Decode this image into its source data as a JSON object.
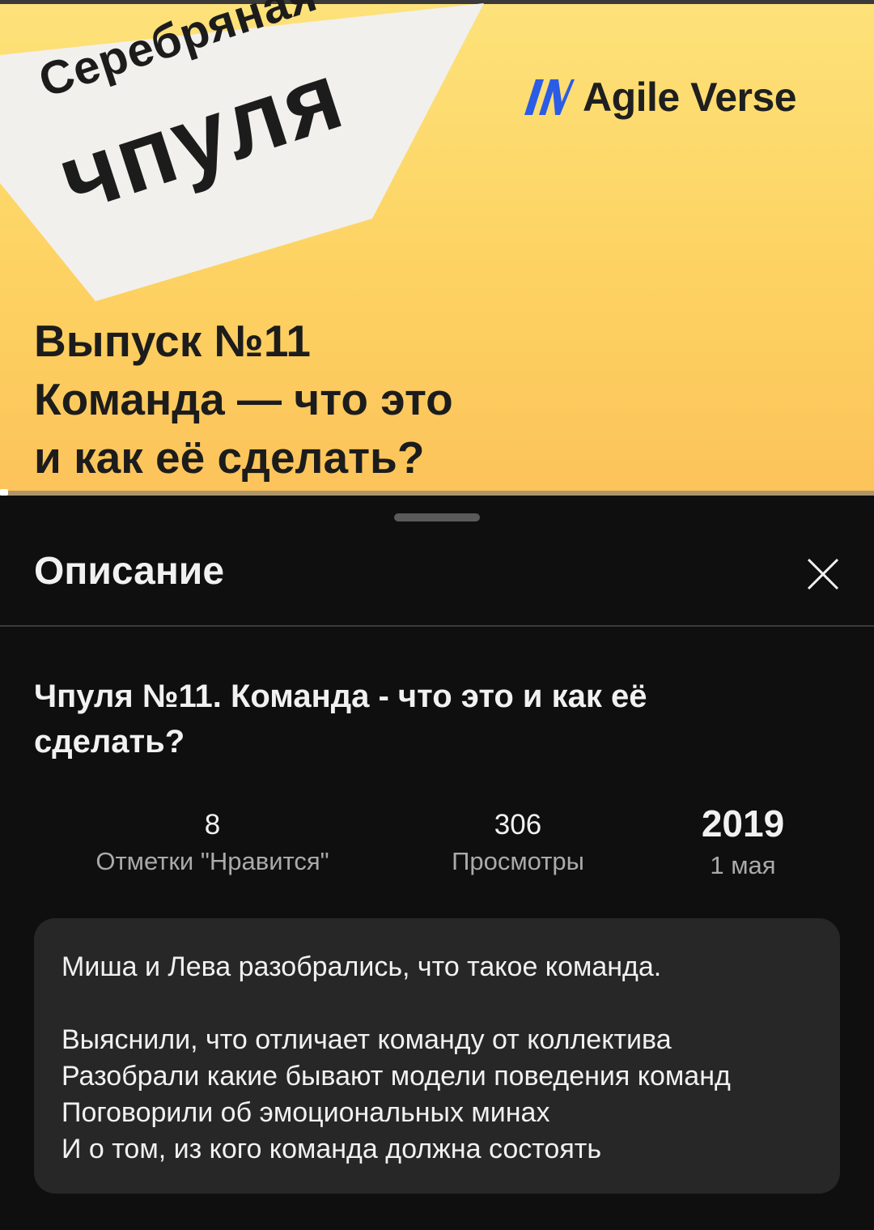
{
  "video": {
    "show_name_line1": "Серебряная",
    "show_name_line2": "чпуля",
    "logo_text": "Agile Verse",
    "episode_line1": "Выпуск №11",
    "episode_line2": "Команда — что это",
    "episode_line3": "и как её сделать?",
    "colors": {
      "background_top": "#fde27a",
      "background_bottom": "#fcc35a",
      "paper": "#f1f0ec",
      "logo_blue": "#2a5ce6"
    }
  },
  "sheet": {
    "title": "Описание",
    "close_icon": "close-icon"
  },
  "video_info": {
    "title": "Чпуля №11. Команда - что это и как её сделать?",
    "likes_value": "8",
    "likes_label": "Отметки \"Нравится\"",
    "views_value": "306",
    "views_label": "Просмотры",
    "year": "2019",
    "date": "1 мая"
  },
  "description": {
    "line1": "Миша и Лева разобрались, что такое команда.",
    "line2": "Выяснили, что отличает команду от коллектива",
    "line3": "Разобрали какие бывают модели поведения команд",
    "line4": "Поговорили об эмоциональных минах",
    "line5": "И о том, из кого команда должна состоять"
  }
}
